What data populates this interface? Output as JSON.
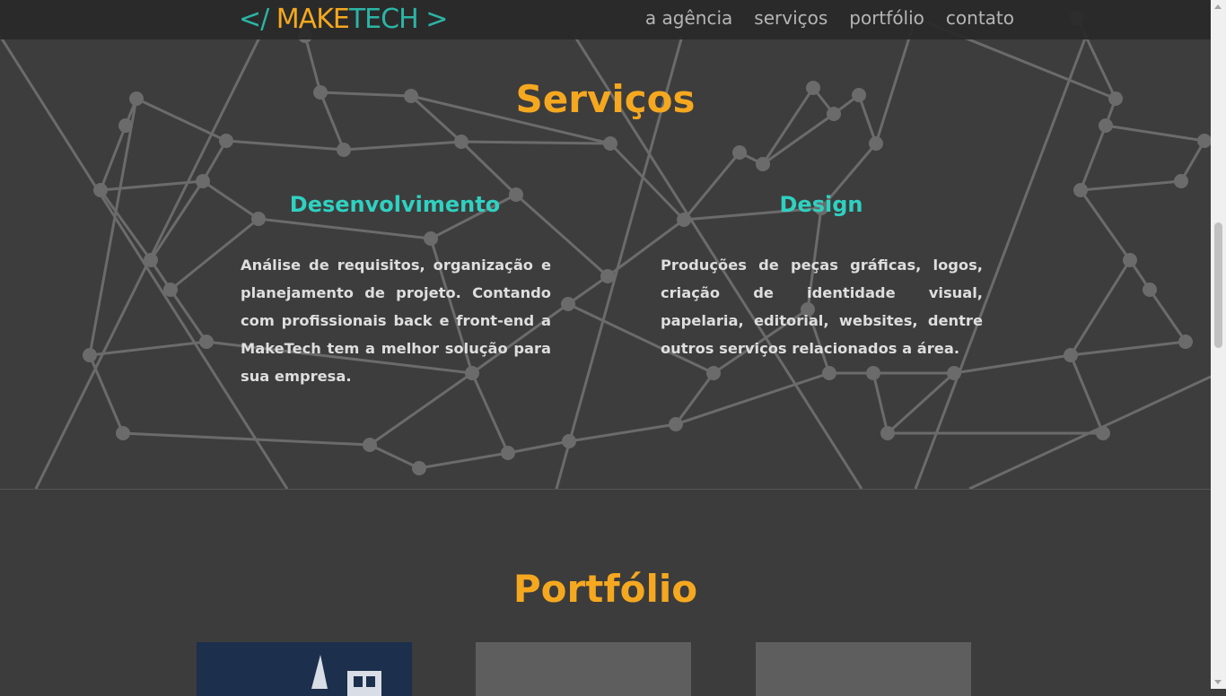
{
  "header": {
    "logo": {
      "bracket_open": "</",
      "brand_a": "MAKE",
      "brand_b": "TECH",
      "bracket_close": ">"
    },
    "nav": [
      "a agência",
      "serviços",
      "portfólio",
      "contato"
    ]
  },
  "services": {
    "title": "Serviços",
    "columns": [
      {
        "title": "Desenvolvimento",
        "text": "Análise de requisitos, organização e planejamento de projeto. Contando com profissionais back e front-end a MakeTech tem a melhor solução para sua empresa."
      },
      {
        "title": "Design",
        "text": "Produções de peças gráficas, logos, criação de identidade visual, papelaria, editorial, websites, dentre outros serviços relacionados a área."
      }
    ]
  },
  "portfolio": {
    "title": "Portfólio"
  },
  "colors": {
    "accent": "#f5a81f",
    "teal": "#2fd1c1",
    "background": "#3e3d3d"
  }
}
